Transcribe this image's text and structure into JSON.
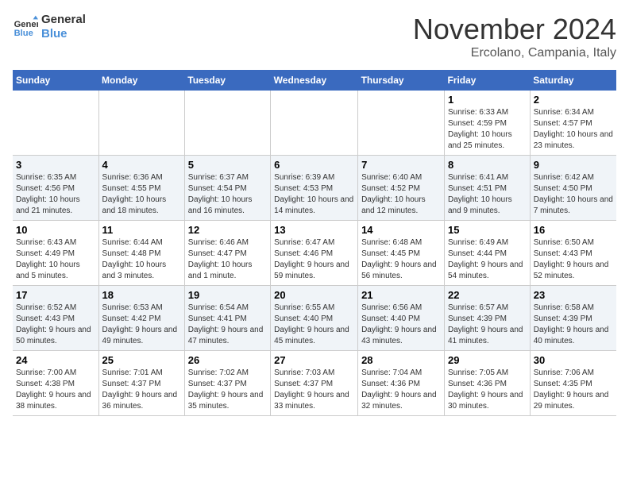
{
  "header": {
    "logo_line1": "General",
    "logo_line2": "Blue",
    "month": "November 2024",
    "location": "Ercolano, Campania, Italy"
  },
  "weekdays": [
    "Sunday",
    "Monday",
    "Tuesday",
    "Wednesday",
    "Thursday",
    "Friday",
    "Saturday"
  ],
  "weeks": [
    [
      {
        "day": "",
        "info": ""
      },
      {
        "day": "",
        "info": ""
      },
      {
        "day": "",
        "info": ""
      },
      {
        "day": "",
        "info": ""
      },
      {
        "day": "",
        "info": ""
      },
      {
        "day": "1",
        "info": "Sunrise: 6:33 AM\nSunset: 4:59 PM\nDaylight: 10 hours and 25 minutes."
      },
      {
        "day": "2",
        "info": "Sunrise: 6:34 AM\nSunset: 4:57 PM\nDaylight: 10 hours and 23 minutes."
      }
    ],
    [
      {
        "day": "3",
        "info": "Sunrise: 6:35 AM\nSunset: 4:56 PM\nDaylight: 10 hours and 21 minutes."
      },
      {
        "day": "4",
        "info": "Sunrise: 6:36 AM\nSunset: 4:55 PM\nDaylight: 10 hours and 18 minutes."
      },
      {
        "day": "5",
        "info": "Sunrise: 6:37 AM\nSunset: 4:54 PM\nDaylight: 10 hours and 16 minutes."
      },
      {
        "day": "6",
        "info": "Sunrise: 6:39 AM\nSunset: 4:53 PM\nDaylight: 10 hours and 14 minutes."
      },
      {
        "day": "7",
        "info": "Sunrise: 6:40 AM\nSunset: 4:52 PM\nDaylight: 10 hours and 12 minutes."
      },
      {
        "day": "8",
        "info": "Sunrise: 6:41 AM\nSunset: 4:51 PM\nDaylight: 10 hours and 9 minutes."
      },
      {
        "day": "9",
        "info": "Sunrise: 6:42 AM\nSunset: 4:50 PM\nDaylight: 10 hours and 7 minutes."
      }
    ],
    [
      {
        "day": "10",
        "info": "Sunrise: 6:43 AM\nSunset: 4:49 PM\nDaylight: 10 hours and 5 minutes."
      },
      {
        "day": "11",
        "info": "Sunrise: 6:44 AM\nSunset: 4:48 PM\nDaylight: 10 hours and 3 minutes."
      },
      {
        "day": "12",
        "info": "Sunrise: 6:46 AM\nSunset: 4:47 PM\nDaylight: 10 hours and 1 minute."
      },
      {
        "day": "13",
        "info": "Sunrise: 6:47 AM\nSunset: 4:46 PM\nDaylight: 9 hours and 59 minutes."
      },
      {
        "day": "14",
        "info": "Sunrise: 6:48 AM\nSunset: 4:45 PM\nDaylight: 9 hours and 56 minutes."
      },
      {
        "day": "15",
        "info": "Sunrise: 6:49 AM\nSunset: 4:44 PM\nDaylight: 9 hours and 54 minutes."
      },
      {
        "day": "16",
        "info": "Sunrise: 6:50 AM\nSunset: 4:43 PM\nDaylight: 9 hours and 52 minutes."
      }
    ],
    [
      {
        "day": "17",
        "info": "Sunrise: 6:52 AM\nSunset: 4:43 PM\nDaylight: 9 hours and 50 minutes."
      },
      {
        "day": "18",
        "info": "Sunrise: 6:53 AM\nSunset: 4:42 PM\nDaylight: 9 hours and 49 minutes."
      },
      {
        "day": "19",
        "info": "Sunrise: 6:54 AM\nSunset: 4:41 PM\nDaylight: 9 hours and 47 minutes."
      },
      {
        "day": "20",
        "info": "Sunrise: 6:55 AM\nSunset: 4:40 PM\nDaylight: 9 hours and 45 minutes."
      },
      {
        "day": "21",
        "info": "Sunrise: 6:56 AM\nSunset: 4:40 PM\nDaylight: 9 hours and 43 minutes."
      },
      {
        "day": "22",
        "info": "Sunrise: 6:57 AM\nSunset: 4:39 PM\nDaylight: 9 hours and 41 minutes."
      },
      {
        "day": "23",
        "info": "Sunrise: 6:58 AM\nSunset: 4:39 PM\nDaylight: 9 hours and 40 minutes."
      }
    ],
    [
      {
        "day": "24",
        "info": "Sunrise: 7:00 AM\nSunset: 4:38 PM\nDaylight: 9 hours and 38 minutes."
      },
      {
        "day": "25",
        "info": "Sunrise: 7:01 AM\nSunset: 4:37 PM\nDaylight: 9 hours and 36 minutes."
      },
      {
        "day": "26",
        "info": "Sunrise: 7:02 AM\nSunset: 4:37 PM\nDaylight: 9 hours and 35 minutes."
      },
      {
        "day": "27",
        "info": "Sunrise: 7:03 AM\nSunset: 4:37 PM\nDaylight: 9 hours and 33 minutes."
      },
      {
        "day": "28",
        "info": "Sunrise: 7:04 AM\nSunset: 4:36 PM\nDaylight: 9 hours and 32 minutes."
      },
      {
        "day": "29",
        "info": "Sunrise: 7:05 AM\nSunset: 4:36 PM\nDaylight: 9 hours and 30 minutes."
      },
      {
        "day": "30",
        "info": "Sunrise: 7:06 AM\nSunset: 4:35 PM\nDaylight: 9 hours and 29 minutes."
      }
    ]
  ]
}
